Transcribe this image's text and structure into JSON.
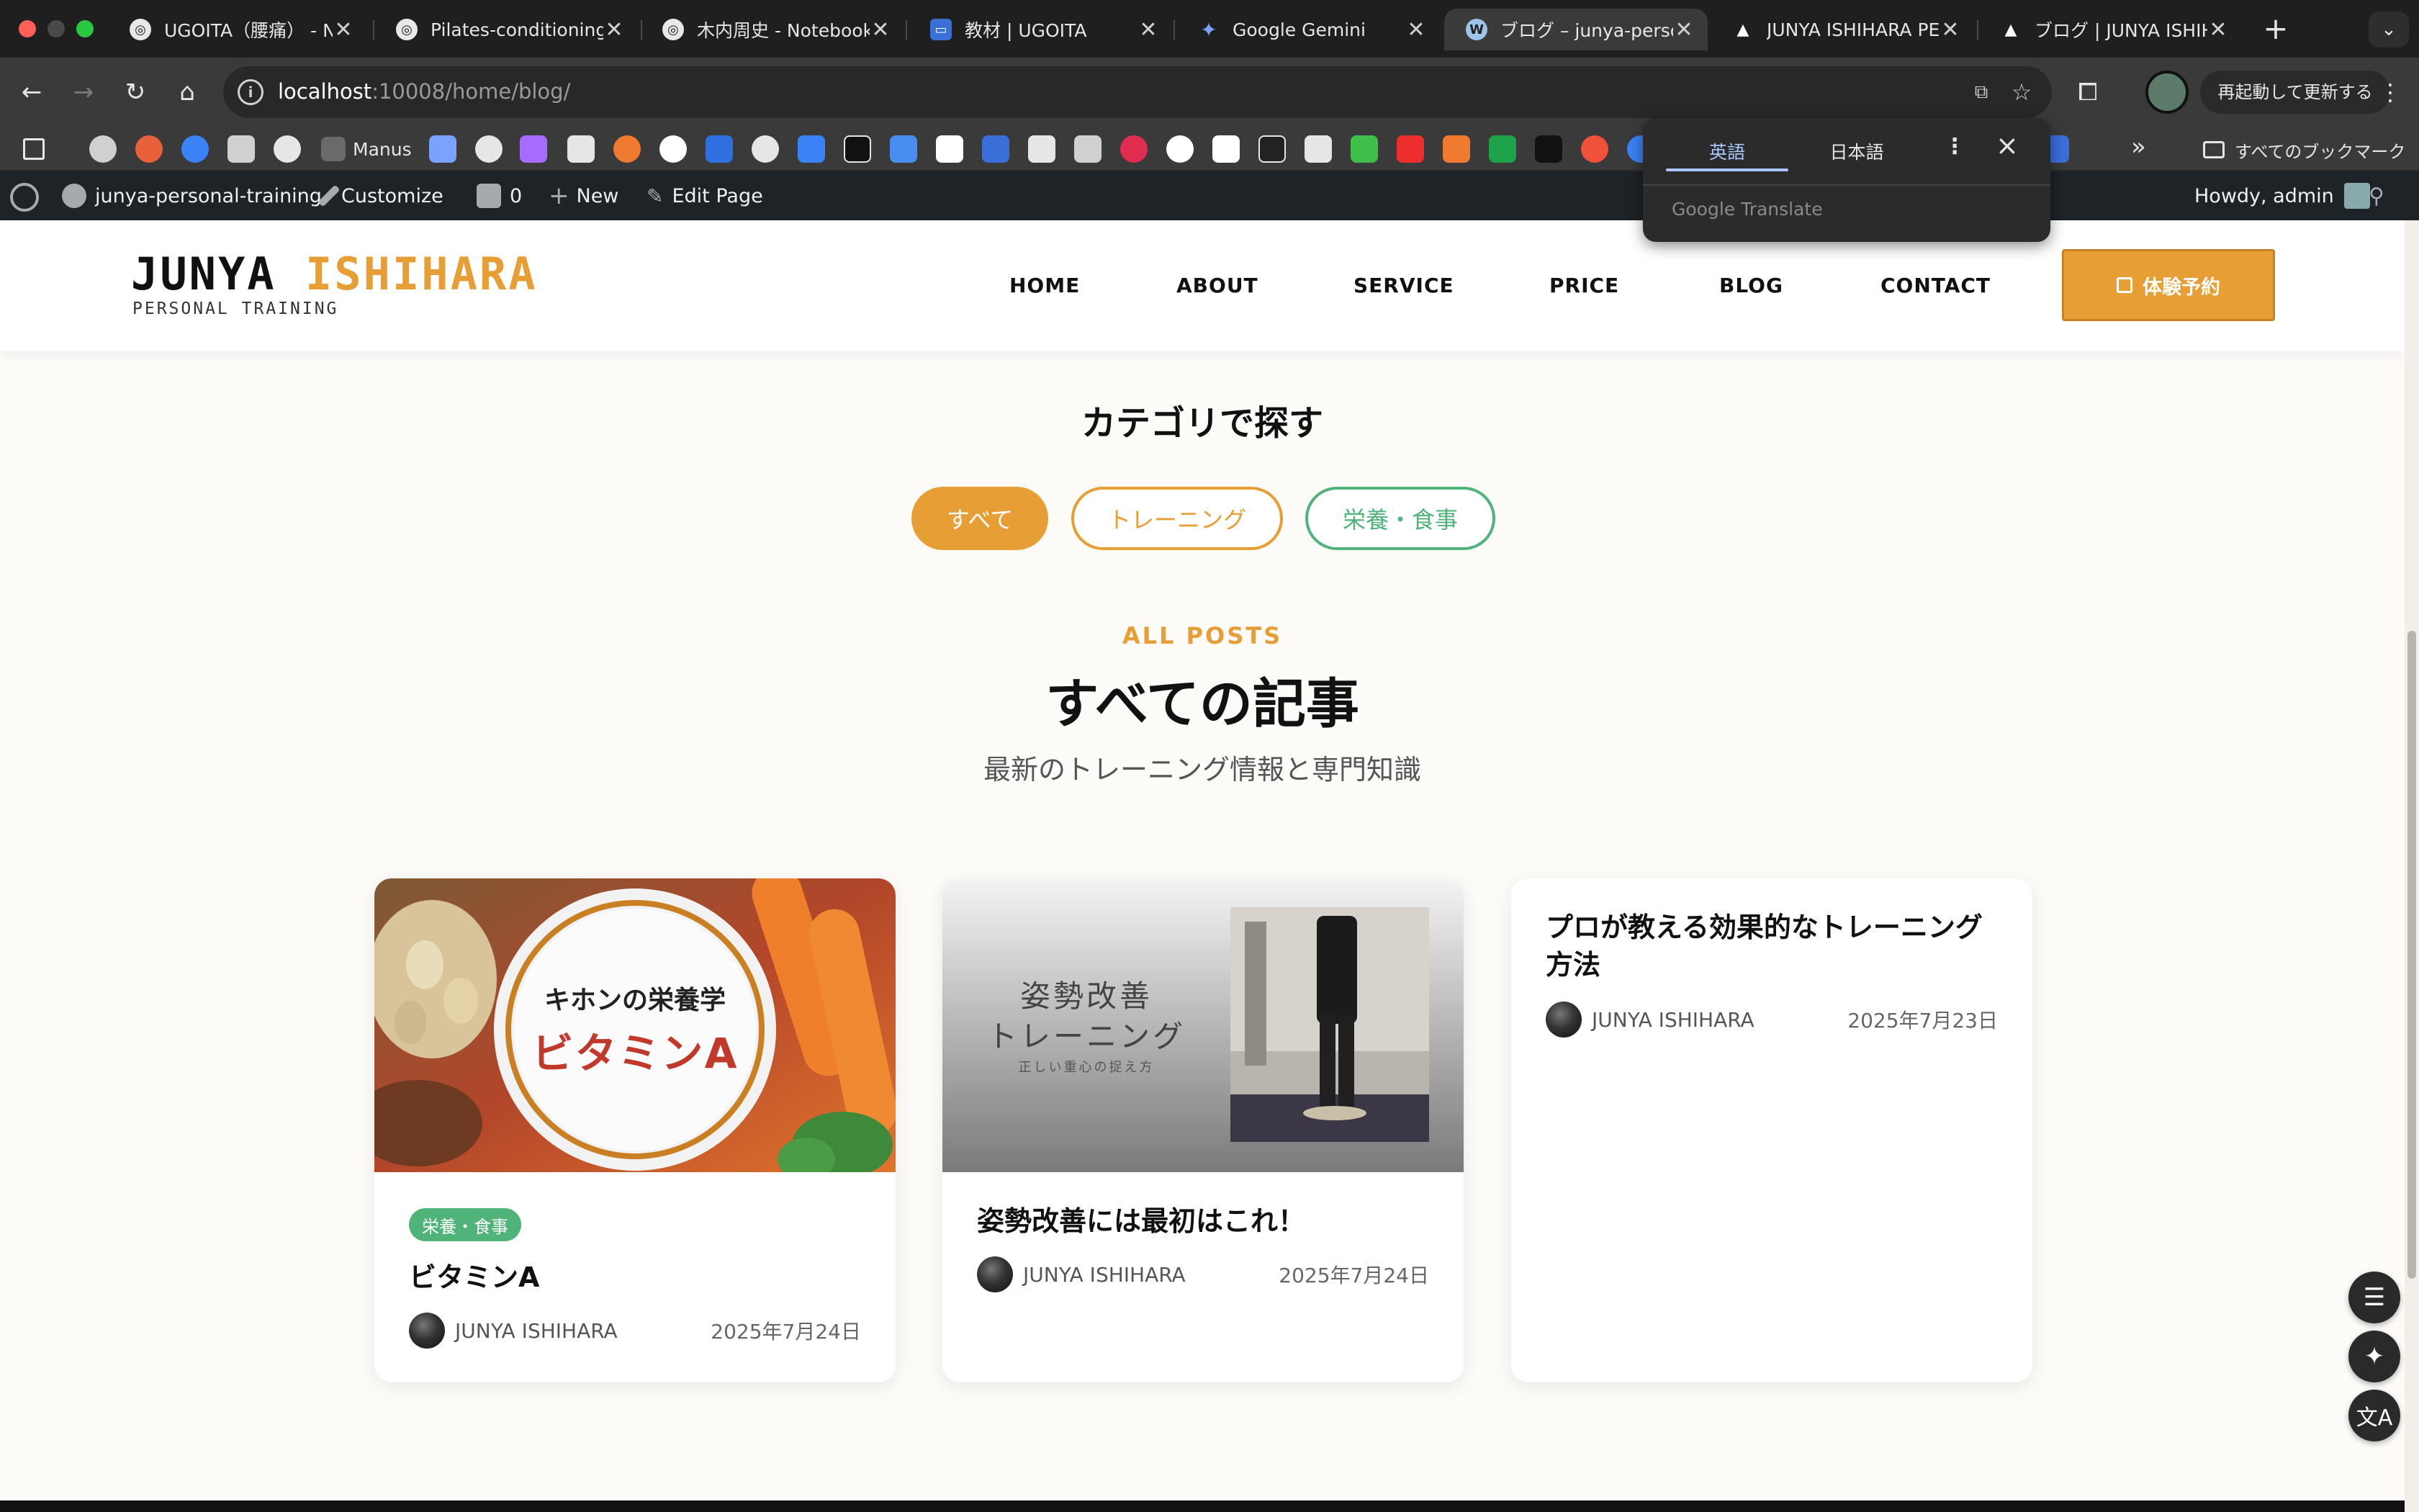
{
  "browser": {
    "tabs": [
      {
        "label": "UGOITA（腰痛） - N",
        "close": "✕"
      },
      {
        "label": "Pilates-conditioning",
        "close": "✕"
      },
      {
        "label": "木内周史 - Notebook",
        "close": "✕"
      },
      {
        "label": "教材 | UGOITA",
        "close": "✕"
      },
      {
        "label": "Google Gemini",
        "close": "✕"
      },
      {
        "label": "ブログ – junya-perso",
        "close": "✕"
      },
      {
        "label": "JUNYA ISHIHARA PE",
        "close": "✕"
      },
      {
        "label": "ブログ | JUNYA ISHIH",
        "close": "✕"
      }
    ],
    "new_tab": "+",
    "tab_menu": "⌄",
    "url_host": "localhost",
    "url_path": ":10008/home/blog/",
    "relaunch_label": "再起動して更新する",
    "bookmark_manus": "Manus",
    "bookmark_all": "すべてのブックマーク",
    "bookmark_more": "»"
  },
  "translate_popup": {
    "tab_english": "英語",
    "tab_japanese": "日本語",
    "brand": "Google Translate"
  },
  "wp_admin": {
    "site_name": "junya-personal-training",
    "customize": "Customize",
    "comments_count": "0",
    "new": "New",
    "edit_page": "Edit Page",
    "howdy": "Howdy, admin"
  },
  "site": {
    "logo_first": "JUNYA",
    "logo_last": "ISHIHARA",
    "logo_sub": "PERSONAL TRAINING",
    "nav": [
      "HOME",
      "ABOUT",
      "SERVICE",
      "PRICE",
      "BLOG",
      "CONTACT"
    ],
    "cta_label": "体験予約"
  },
  "categories": {
    "title": "カテゴリで探す",
    "all": "すべて",
    "training": "トレーニング",
    "nutrition": "栄養・食事"
  },
  "posts_section": {
    "eyebrow": "ALL POSTS",
    "title": "すべての記事",
    "subtitle": "最新のトレーニング情報と専門知識"
  },
  "posts": [
    {
      "badge": "栄養・食事",
      "title": "ビタミンA",
      "author": "JUNYA ISHIHARA",
      "date": "2025年7月24日",
      "thumb_line1": "キホンの栄養学",
      "thumb_line2": "ビタミンA"
    },
    {
      "title": "姿勢改善には最初はこれ！",
      "author": "JUNYA ISHIHARA",
      "date": "2025年7月24日",
      "thumb_line1": "姿勢改善",
      "thumb_line2": "トレーニング",
      "thumb_line3": "正しい重心の捉え方"
    },
    {
      "title": "プロが教える効果的なトレーニング方法",
      "author": "JUNYA ISHIHARA",
      "date": "2025年7月23日"
    }
  ],
  "colors": {
    "accent": "#e79f35",
    "green": "#4fb37a",
    "chrome_dark": "#1f1f1f",
    "wp_bar": "#1d2327"
  }
}
